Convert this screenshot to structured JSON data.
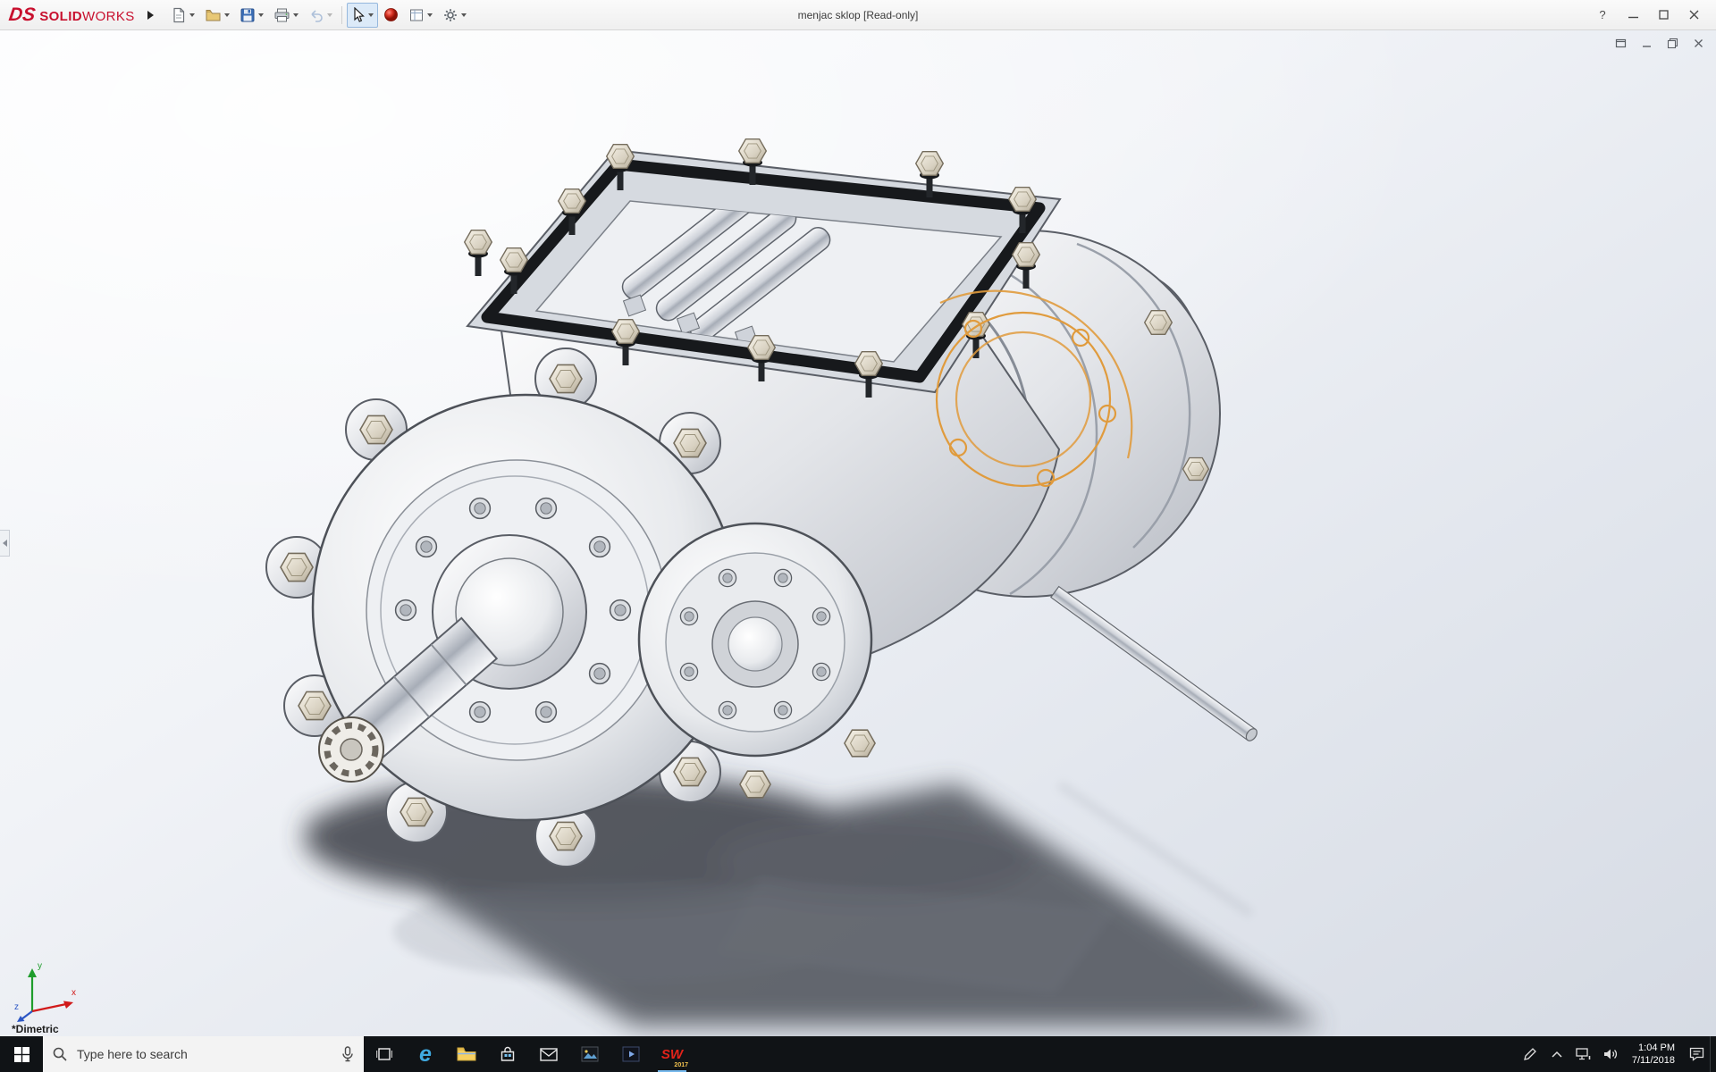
{
  "app": {
    "logo_ds": "DS",
    "brand_solid": "SOLID",
    "brand_works": "WORKS",
    "title": "menjac sklop [Read-only]"
  },
  "titlebar": {
    "help_glyph": "?"
  },
  "toolbar": {
    "items": [
      {
        "name": "new-document"
      },
      {
        "name": "open-document"
      },
      {
        "name": "save-document"
      },
      {
        "name": "print-document"
      },
      {
        "name": "undo"
      },
      {
        "name": "select-tool"
      },
      {
        "name": "appearance-sphere"
      },
      {
        "name": "drawing-sheet"
      },
      {
        "name": "options-gear"
      }
    ]
  },
  "viewport": {
    "view_orientation": "*Dimetric",
    "triad": {
      "x": "x",
      "y": "y",
      "z": "z"
    }
  },
  "taskbar": {
    "search_placeholder": "Type here to search",
    "edge_letter": "e",
    "sw_label": "SW",
    "sw_year": "2017",
    "clock_time": "1:04 PM",
    "clock_date": "7/11/2018"
  },
  "colors": {
    "brand_red": "#c8102e",
    "sw_icon_red": "#e2231a",
    "selection_orange": "#e09b3d",
    "taskbar_bg": "#101316",
    "running_indicator": "#76b9ed"
  }
}
